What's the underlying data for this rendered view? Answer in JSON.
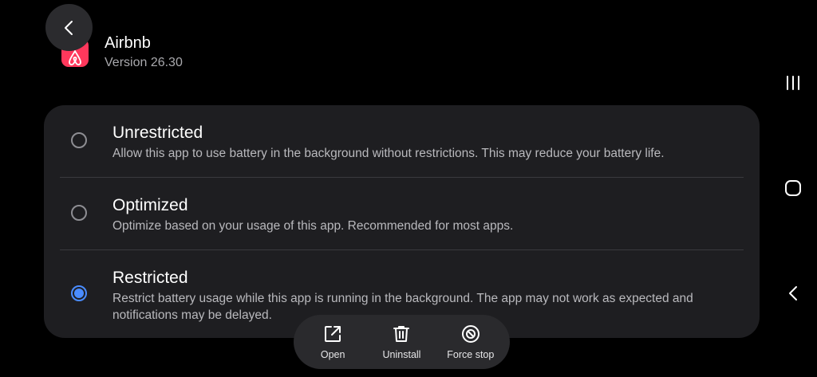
{
  "header": {
    "back_icon": "chevron-left-icon",
    "app_icon": "airbnb-logo",
    "app_name": "Airbnb",
    "app_version": "Version 26.30"
  },
  "options": [
    {
      "title": "Unrestricted",
      "description": "Allow this app to use battery in the background without restrictions. This may reduce your battery life.",
      "selected": false
    },
    {
      "title": "Optimized",
      "description": "Optimize based on your usage of this app. Recommended for most apps.",
      "selected": false
    },
    {
      "title": "Restricted",
      "description": "Restrict battery usage while this app is running in the background. The app may not work as expected and notifications may be delayed.",
      "selected": true
    }
  ],
  "actions": [
    {
      "label": "Open",
      "icon": "open-external-icon"
    },
    {
      "label": "Uninstall",
      "icon": "trash-icon"
    },
    {
      "label": "Force stop",
      "icon": "force-stop-icon"
    }
  ],
  "nav": {
    "recents": "recents-icon",
    "home": "home-icon",
    "back": "back-icon"
  },
  "colors": {
    "accent": "#4a8cff",
    "airbnb": "#ff385c",
    "card": "#1e1e21"
  }
}
